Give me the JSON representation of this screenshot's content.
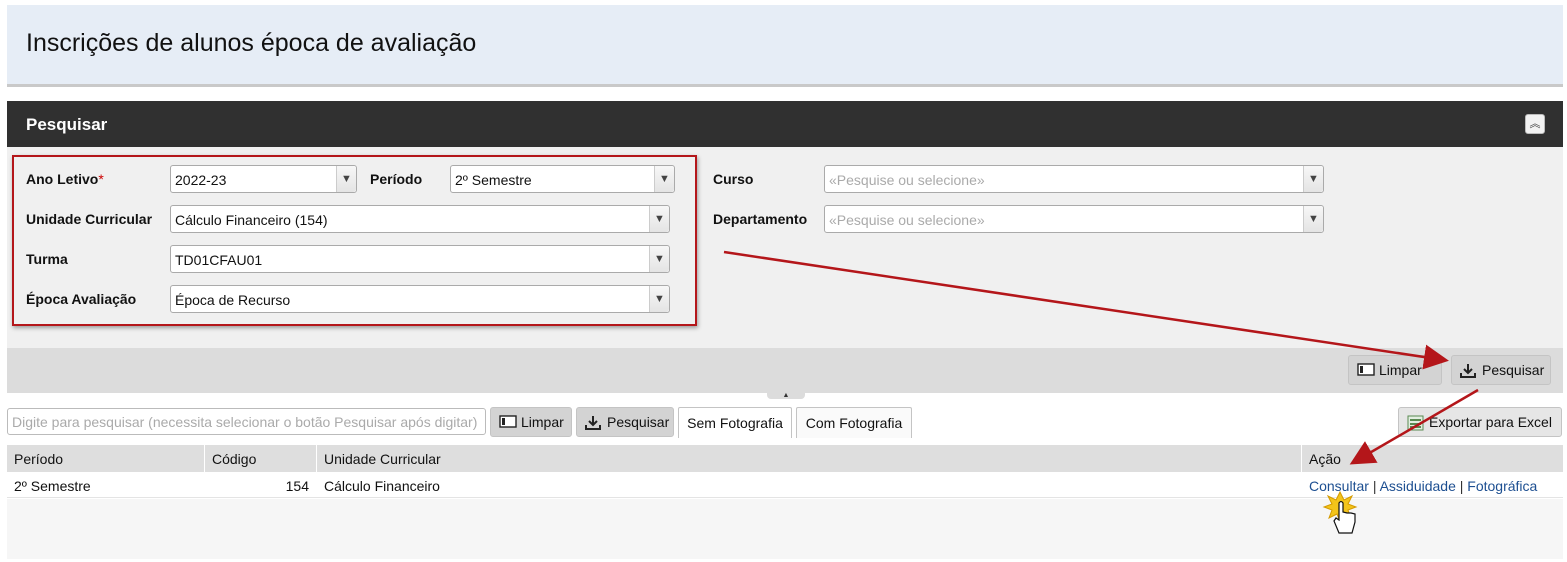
{
  "page": {
    "title": "Inscrições de alunos época de avaliação"
  },
  "panel": {
    "title": "Pesquisar",
    "collapse_icon": "double-chevron-up-icon"
  },
  "form": {
    "ano_letivo": {
      "label": "Ano Letivo",
      "required_mark": "*",
      "value": "2022-23"
    },
    "periodo": {
      "label": "Período",
      "value": "2º Semestre"
    },
    "unidade_curricular": {
      "label": "Unidade Curricular",
      "value": "Cálculo Financeiro (154)"
    },
    "turma": {
      "label": "Turma",
      "value": "TD01CFAU01"
    },
    "epoca_avaliacao": {
      "label": "Época Avaliação",
      "value": "Época de Recurso"
    },
    "curso": {
      "label": "Curso",
      "placeholder": "«Pesquise ou selecione»"
    },
    "departamento": {
      "label": "Departamento",
      "placeholder": "«Pesquise ou selecione»"
    }
  },
  "actions": {
    "limpar": "Limpar",
    "pesquisar": "Pesquisar"
  },
  "grid_toolbar": {
    "search_placeholder": "Digite para pesquisar (necessita selecionar o botão Pesquisar após digitar)",
    "limpar": "Limpar",
    "pesquisar": "Pesquisar",
    "tabs": [
      "Sem Fotografia",
      "Com Fotografia"
    ],
    "export": "Exportar para Excel"
  },
  "table": {
    "columns": [
      "Período",
      "Código",
      "Unidade Curricular",
      "Ação"
    ],
    "rows": [
      {
        "periodo": "2º Semestre",
        "codigo": "154",
        "unidade": "Cálculo Financeiro",
        "acoes": [
          "Consultar",
          "Assiduidade",
          "Fotográfica"
        ],
        "separator": "|"
      }
    ]
  },
  "colors": {
    "header_bg": "#e6edf6",
    "panel_bg": "#303030",
    "annotation": "#b4161a",
    "link": "#1d4f91"
  }
}
